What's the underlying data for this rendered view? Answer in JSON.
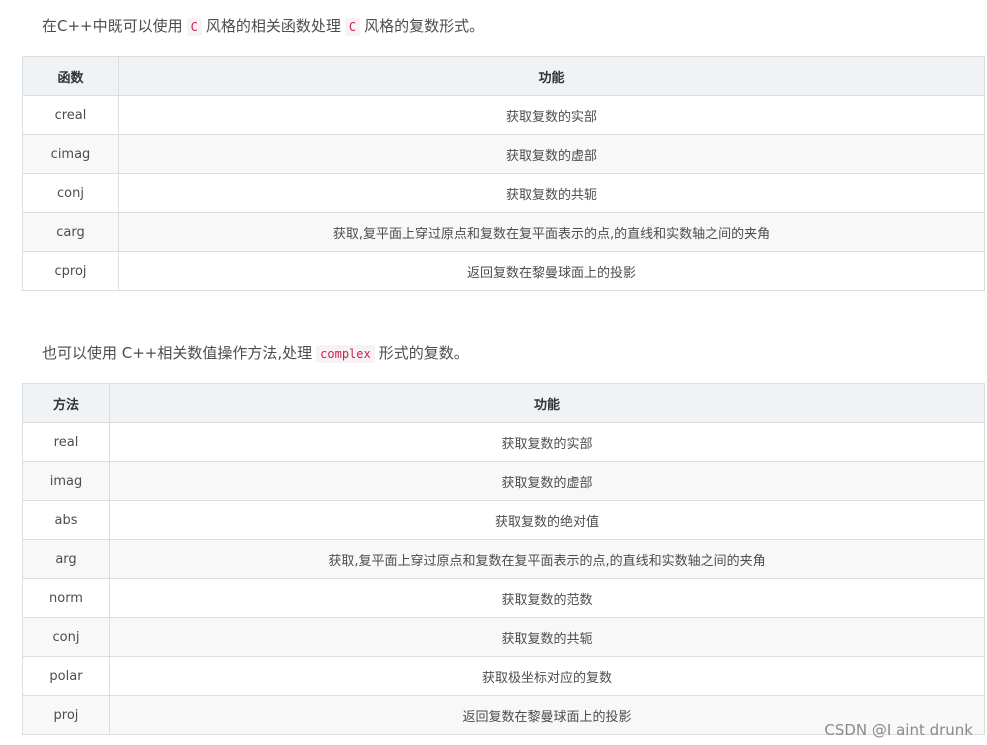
{
  "intro1": {
    "before": "在C++中既可以使用",
    "code1": "C",
    "middle": "风格的相关函数处理",
    "code2": "C",
    "after": "风格的复数形式。"
  },
  "table1": {
    "headers": [
      "函数",
      "功能"
    ],
    "rows": [
      [
        "creal",
        "获取复数的实部"
      ],
      [
        "cimag",
        "获取复数的虚部"
      ],
      [
        "conj",
        "获取复数的共轭"
      ],
      [
        "carg",
        "获取,复平面上穿过原点和复数在复平面表示的点,的直线和实数轴之间的夹角"
      ],
      [
        "cproj",
        "返回复数在黎曼球面上的投影"
      ]
    ]
  },
  "intro2": {
    "before": "也可以使用 C++相关数值操作方法,处理",
    "code": "complex",
    "after": "形式的复数。"
  },
  "table2": {
    "headers": [
      "方法",
      "功能"
    ],
    "rows": [
      [
        "real",
        "获取复数的实部"
      ],
      [
        "imag",
        "获取复数的虚部"
      ],
      [
        "abs",
        "获取复数的绝对值"
      ],
      [
        "arg",
        "获取,复平面上穿过原点和复数在复平面表示的点,的直线和实数轴之间的夹角"
      ],
      [
        "norm",
        "获取复数的范数"
      ],
      [
        "conj",
        "获取复数的共轭"
      ],
      [
        "polar",
        "获取极坐标对应的复数"
      ],
      [
        "proj",
        "返回复数在黎曼球面上的投影"
      ]
    ]
  },
  "watermark": "CSDN @I aint drunk"
}
